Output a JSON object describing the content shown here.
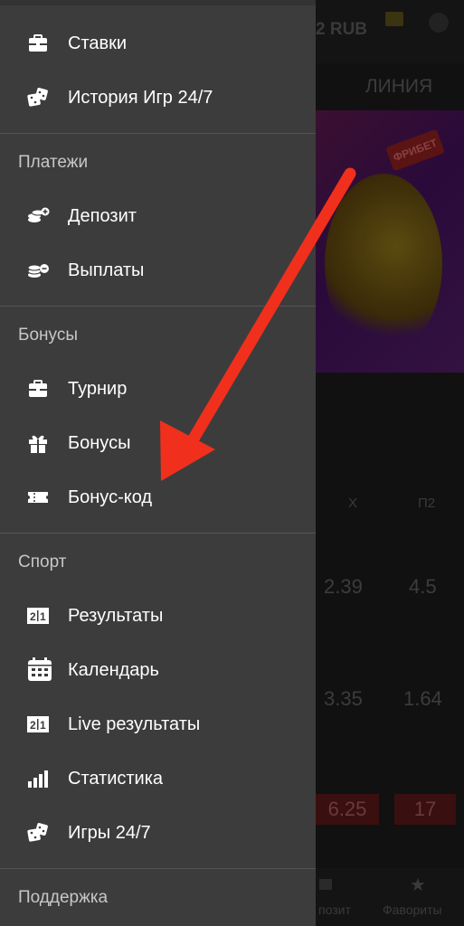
{
  "background": {
    "balance": "2 RUB",
    "tab": "ЛИНИЯ",
    "banner_text": "ФРИБЕТ",
    "col_x": "Х",
    "col_p2": "П2",
    "odds": [
      "2.39",
      "4.5",
      "3.35",
      "1.64",
      "6.25",
      "17"
    ],
    "bottom_deposit": "позит",
    "bottom_favorites": "Фавориты"
  },
  "drawer": {
    "items_top": [
      {
        "label": "Ставки",
        "icon": "briefcase-icon"
      },
      {
        "label": "История Игр 24/7",
        "icon": "dice-icon"
      }
    ],
    "sections": {
      "payments": "Платежи",
      "bonuses": "Бонусы",
      "sport": "Спорт",
      "support": "Поддержка"
    },
    "payments": [
      {
        "label": "Депозит",
        "icon": "coins-plus-icon"
      },
      {
        "label": "Выплаты",
        "icon": "coins-minus-icon"
      }
    ],
    "bonuses": [
      {
        "label": "Турнир",
        "icon": "briefcase-icon"
      },
      {
        "label": "Бонусы",
        "icon": "gift-icon"
      },
      {
        "label": "Бонус-код",
        "icon": "ticket-icon"
      }
    ],
    "sport": [
      {
        "label": "Результаты",
        "icon": "scoreboard-icon"
      },
      {
        "label": "Календарь",
        "icon": "calendar-icon"
      },
      {
        "label": "Live результаты",
        "icon": "scoreboard-icon"
      },
      {
        "label": "Статистика",
        "icon": "bar-chart-icon"
      },
      {
        "label": "Игры 24/7",
        "icon": "dice-icon"
      }
    ]
  },
  "colors": {
    "drawer_bg": "#3c3c3c",
    "arrow": "#f0301c",
    "text": "#ffffff",
    "section_text": "#c7c7c7"
  }
}
